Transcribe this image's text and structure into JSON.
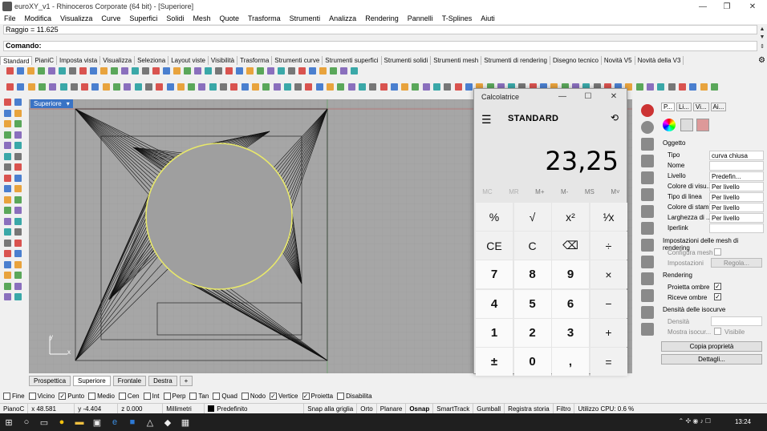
{
  "window": {
    "title": "euroXY_v1 - Rhinoceros Corporate (64 bit) - [Superiore]",
    "controls": [
      "—",
      "❐",
      "✕"
    ]
  },
  "menu": [
    "File",
    "Modifica",
    "Visualizza",
    "Curve",
    "Superfici",
    "Solidi",
    "Mesh",
    "Quote",
    "Trasforma",
    "Strumenti",
    "Analizza",
    "Rendering",
    "Pannelli",
    "T-Splines",
    "Aiuti"
  ],
  "command_history": "Raggio = 11.625",
  "command_prompt": "Comando:",
  "toolbar_tabs": [
    "Standard",
    "PianiC",
    "Imposta vista",
    "Visualizza",
    "Seleziona",
    "Layout viste",
    "Visibilità",
    "Trasforma",
    "Strumenti curve",
    "Strumenti superfici",
    "Strumenti solidi",
    "Strumenti mesh",
    "Strumenti di rendering",
    "Disegno tecnico",
    "Novità V5",
    "Novità della V3"
  ],
  "viewport": {
    "label": "Superiore",
    "axis_y": "y",
    "axis_x": "x",
    "tabs": [
      "Prospettica",
      "Superiore",
      "Frontale",
      "Destra",
      "+"
    ],
    "active_tab": "Superiore"
  },
  "calculator": {
    "title": "Calcolatrice",
    "mode": "STANDARD",
    "display": "23,25",
    "memory": [
      "MC",
      "MR",
      "M+",
      "M-",
      "MS",
      "M˅"
    ],
    "keys": [
      [
        "%",
        "√",
        "x²",
        "¹⁄x"
      ],
      [
        "CE",
        "C",
        "⌫",
        "÷"
      ],
      [
        "7",
        "8",
        "9",
        "×"
      ],
      [
        "4",
        "5",
        "6",
        "−"
      ],
      [
        "1",
        "2",
        "3",
        "+"
      ],
      [
        "±",
        "0",
        ",",
        "="
      ]
    ]
  },
  "properties_panel": {
    "tabs": [
      "P...",
      "Li...",
      "Vi...",
      "Ai..."
    ],
    "section_object": "Oggetto",
    "rows": [
      {
        "label": "Tipo",
        "value": "curva chiusa"
      },
      {
        "label": "Nome",
        "value": ""
      },
      {
        "label": "Livello",
        "value": "Predefin..."
      },
      {
        "label": "Colore di visu...",
        "value": "Per livello"
      },
      {
        "label": "Tipo di linea",
        "value": "Per livello"
      },
      {
        "label": "Colore di stam...",
        "value": "Per livello"
      },
      {
        "label": "Larghezza di ...",
        "value": "Per livello"
      },
      {
        "label": "Iperlink",
        "value": ""
      }
    ],
    "mesh_section": "Impostazioni delle mesh di rendering",
    "mesh_config": "Configura mesh",
    "mesh_settings": "Impostazioni",
    "mesh_adjust": "Regola...",
    "rendering_section": "Rendering",
    "cast_shadows": "Proietta ombre",
    "receive_shadows": "Riceve ombre",
    "isocurve_section": "Densità delle isocurve",
    "density": "Densità",
    "show_isocurves": "Mostra isocur...",
    "visible": "Visibile",
    "copy_props": "Copia proprietà",
    "details": "Dettagli..."
  },
  "osnap": [
    {
      "label": "Fine",
      "checked": false
    },
    {
      "label": "Vicino",
      "checked": false
    },
    {
      "label": "Punto",
      "checked": true
    },
    {
      "label": "Medio",
      "checked": false
    },
    {
      "label": "Cen",
      "checked": false
    },
    {
      "label": "Int",
      "checked": false
    },
    {
      "label": "Perp",
      "checked": false
    },
    {
      "label": "Tan",
      "checked": false
    },
    {
      "label": "Quad",
      "checked": false
    },
    {
      "label": "Nodo",
      "checked": false
    },
    {
      "label": "Vertice",
      "checked": true
    },
    {
      "label": "Proietta",
      "checked": true
    },
    {
      "label": "Disabilita",
      "checked": false
    }
  ],
  "status": {
    "plane": "PianoC",
    "x": "x 48.581",
    "y": "y -4.404",
    "z": "z 0.000",
    "units": "Millimetri",
    "layer": "Predefinito",
    "items": [
      "Snap alla griglia",
      "Orto",
      "Planare",
      "Osnap",
      "SmartTrack",
      "Gumball",
      "Registra storia",
      "Filtro"
    ],
    "cpu": "Utilizzo CPU: 0.6 %"
  },
  "taskbar": {
    "clock": "13:24"
  },
  "colors": {
    "viewport_bg": "#a6a6a6",
    "circle": "#e8e86a",
    "accent": "#3a73c5",
    "taskbar": "#1f1f1f"
  }
}
